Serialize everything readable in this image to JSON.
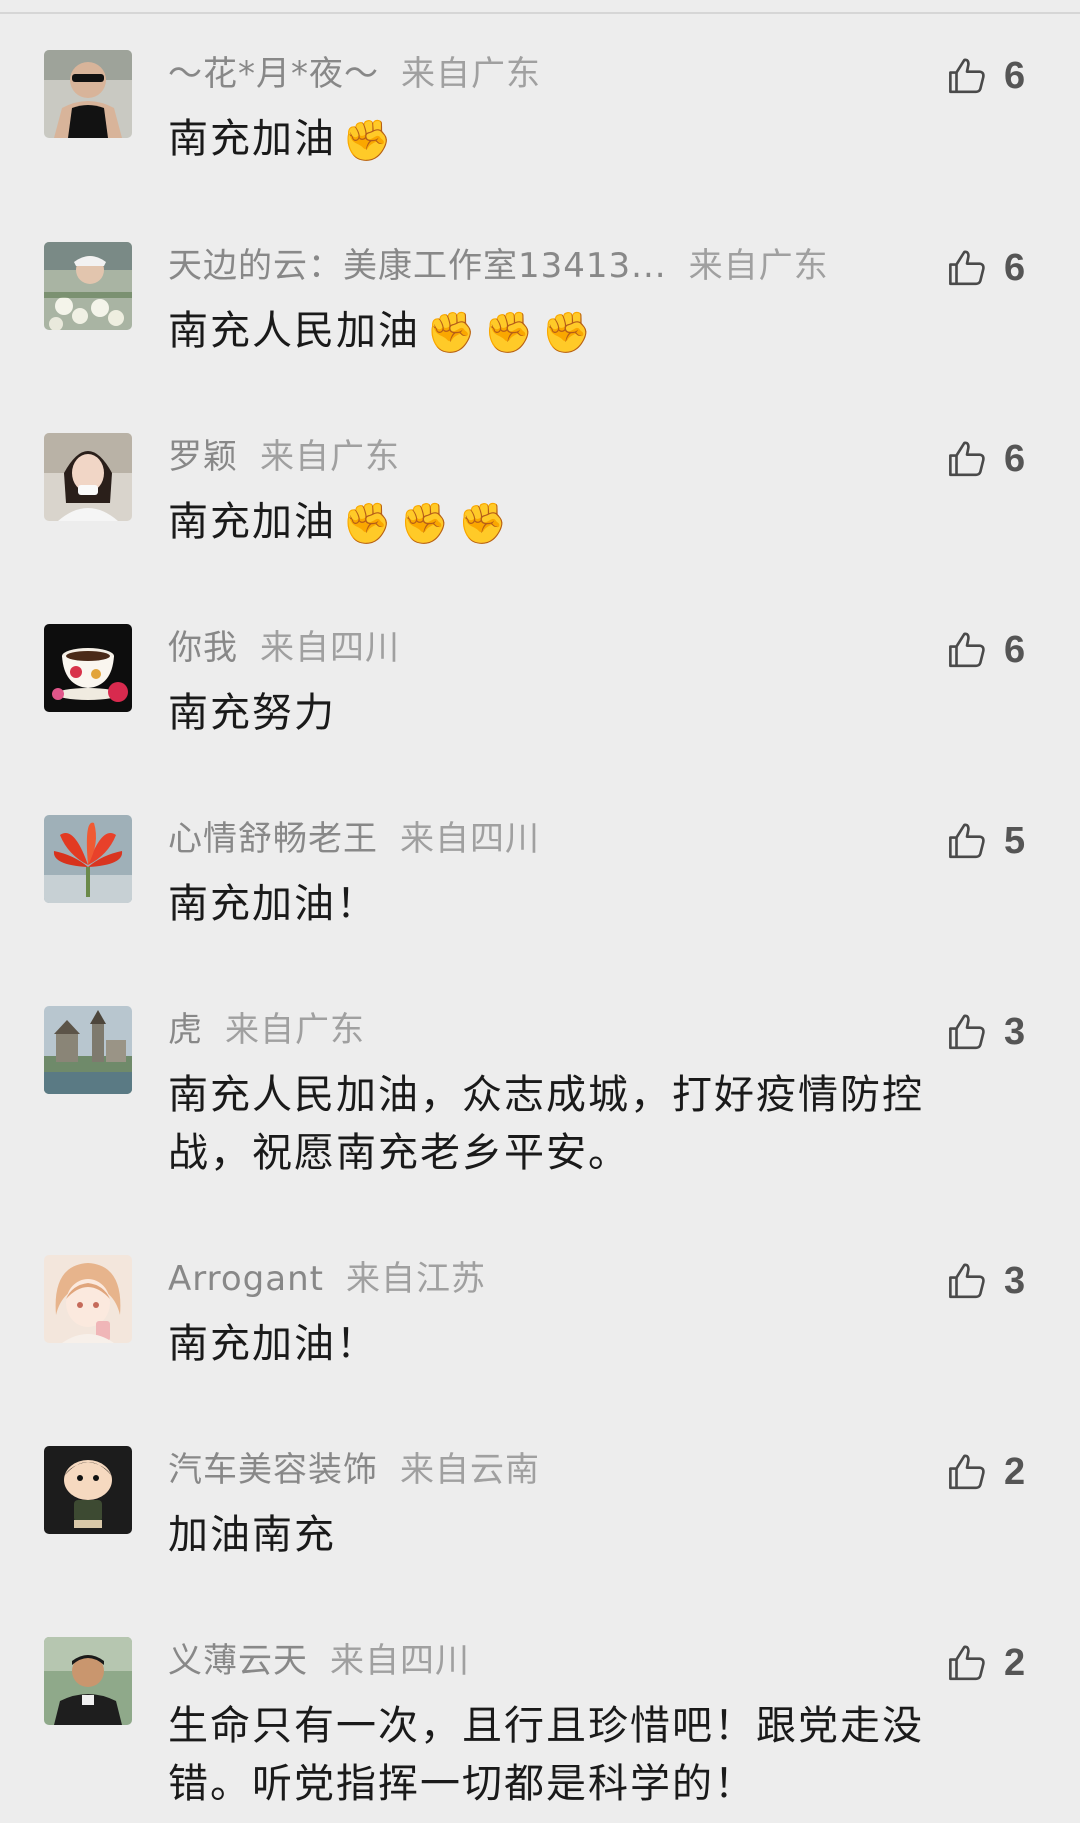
{
  "comments": [
    {
      "author": "～花*月*夜～",
      "location": "来自广东",
      "text": "南充加油",
      "emoji": "✊",
      "emoji_count": 1,
      "likes": "6",
      "avatar": "man-black-tank-top"
    },
    {
      "author": "天边的云：美康工作室13413...",
      "location": "来自广东",
      "text": "南充人民加油",
      "emoji": "✊",
      "emoji_count": 3,
      "likes": "6",
      "avatar": "man-with-flowers"
    },
    {
      "author": "罗颖",
      "location": "来自广东",
      "text": "南充加油",
      "emoji": "✊",
      "emoji_count": 3,
      "likes": "6",
      "avatar": "woman-portrait"
    },
    {
      "author": "你我",
      "location": "来自四川",
      "text": "南充努力",
      "emoji": "",
      "emoji_count": 0,
      "likes": "6",
      "avatar": "teacup-roses"
    },
    {
      "author": "心情舒畅老王",
      "location": "来自四川",
      "text": "南充加油！",
      "emoji": "",
      "emoji_count": 0,
      "likes": "5",
      "avatar": "red-flower"
    },
    {
      "author": "虎",
      "location": "来自广东",
      "text": "南充人民加油，众志成城，打好疫情防控战，祝愿南充老乡平安。",
      "emoji": "",
      "emoji_count": 0,
      "likes": "3",
      "avatar": "castle-lake"
    },
    {
      "author": "Arrogant",
      "location": "来自江苏",
      "text": "南充加油！",
      "emoji": "",
      "emoji_count": 0,
      "likes": "3",
      "avatar": "anime-girl"
    },
    {
      "author": "汽车美容装饰",
      "location": "来自云南",
      "text": "加油南充",
      "emoji": "",
      "emoji_count": 0,
      "likes": "2",
      "avatar": "cartoon-boy"
    },
    {
      "author": "义薄云天",
      "location": "来自四川",
      "text": "生命只有一次，且行且珍惜吧！跟党走没错。听党指挥一切都是科学的！",
      "emoji": "",
      "emoji_count": 0,
      "likes": "2",
      "avatar": "man-outdoor"
    }
  ],
  "icons": {
    "like": "thumbs-up-icon",
    "emoji": "raised-fist-emoji"
  },
  "colors": {
    "background": "#ededed",
    "author": "#888888",
    "content": "#1a1a1a",
    "like_count": "#555555"
  }
}
